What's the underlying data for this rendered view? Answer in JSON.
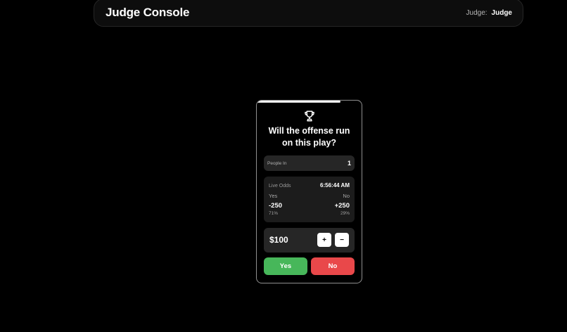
{
  "header": {
    "title": "Judge Console",
    "judge_label": "Judge:",
    "judge_name": "Judge"
  },
  "card": {
    "progress_fraction": 0.8,
    "icon": "trophy-icon",
    "question": "Will the offense run on this play?",
    "people": {
      "label": "People In",
      "count": "1"
    },
    "odds": {
      "title": "Live Odds",
      "time": "6:56:44 AM",
      "yes": {
        "label": "Yes",
        "odds": "-250",
        "pct": "71%"
      },
      "no": {
        "label": "No",
        "odds": "+250",
        "pct": "29%"
      }
    },
    "amount": {
      "value": "$100",
      "plus_label": "+",
      "minus_label": "−"
    },
    "buttons": {
      "yes": "Yes",
      "no": "No"
    }
  },
  "colors": {
    "background": "#000000",
    "yes": "#47b75a",
    "no": "#e9484a"
  }
}
